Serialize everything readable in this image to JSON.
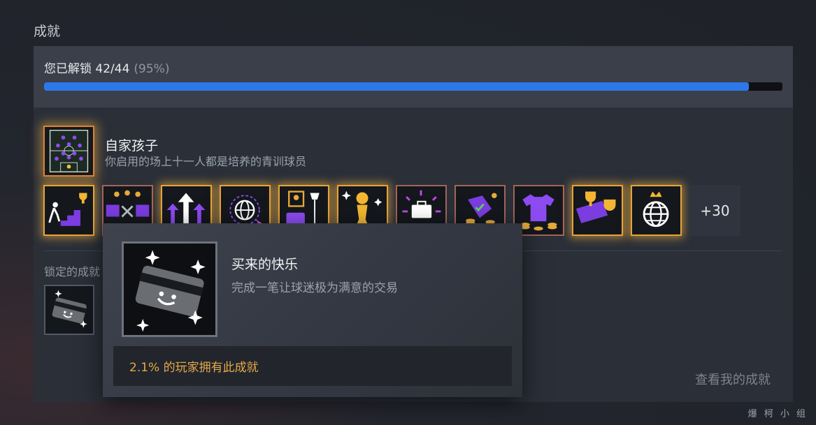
{
  "section": {
    "title": "成就"
  },
  "progress": {
    "label": "您已解锁 42/44",
    "percent_text": "(95%)",
    "fraction": 0.955
  },
  "featured": {
    "name": "自家孩子",
    "description": "你启用的场上十一人都是培养的青训球员",
    "icon": "football-pitch-icon"
  },
  "achievements": [
    {
      "icon": "stairs-trophy-icon",
      "glow": true
    },
    {
      "icon": "boxes-coins-icon",
      "glow": false
    },
    {
      "icon": "up-arrows-icon",
      "glow": true
    },
    {
      "icon": "globe-plane-icon",
      "glow": true
    },
    {
      "icon": "portrait-lamp-icon",
      "glow": true
    },
    {
      "icon": "gold-figure-icon",
      "glow": true
    },
    {
      "icon": "briefcase-burst-icon",
      "glow": false
    },
    {
      "icon": "price-tag-coins-icon",
      "glow": false
    },
    {
      "icon": "jersey-coins-icon",
      "glow": false
    },
    {
      "icon": "scarf-trophies-icon",
      "glow": true
    },
    {
      "icon": "globe-crown-icon",
      "glow": true
    }
  ],
  "more_count": "+30",
  "locked": {
    "label": "锁定的成就",
    "icon": "smiling-card-icon"
  },
  "view_mine": "查看我的成就",
  "tooltip": {
    "name": "买来的快乐",
    "description": "完成一笔让球迷极为满意的交易",
    "rarity": "2.1% 的玩家拥有此成就",
    "icon": "smiling-card-icon"
  },
  "watermark": "爆 柯 小 组"
}
